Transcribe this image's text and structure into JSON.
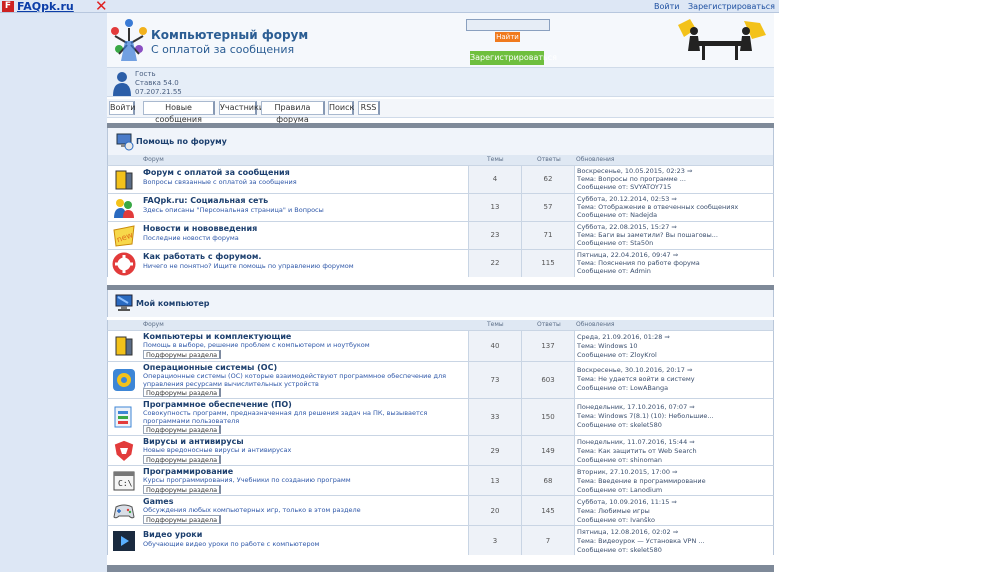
{
  "topbar": {
    "badge": "F",
    "site": "FAQpk.ru",
    "close": "✕",
    "links": [
      "Войти",
      "Зарегистрироваться"
    ]
  },
  "header": {
    "title": "Компьютерный форум",
    "subtitle": "С оплатой за сообщения",
    "search_button": "Найти",
    "search_value": "",
    "register_button": "Зарегистрироваться"
  },
  "userbar": {
    "lines": [
      "Гость",
      "Ставка 54.0",
      "07.207.21.55"
    ]
  },
  "nav": {
    "tabs": [
      "Войти",
      "Новые сообщения",
      "Участники",
      "Правила форума",
      "Поиск",
      "RSS"
    ]
  },
  "columns": {
    "forum": "Форум",
    "topics": "Темы",
    "posts": "Ответы",
    "last": "Обновления"
  },
  "categories": [
    {
      "title": "Помощь по форуму",
      "forums": [
        {
          "title": "Форум с оплатой за сообщения",
          "desc": "Вопросы связанные с оплатой за сообщения",
          "topics": "4",
          "posts": "62",
          "last": [
            "Воскресенье, 10.05.2015, 02:23 ⇒",
            "Тема: Вопросы по программе ...",
            "Сообщение от: SVYATOY715"
          ]
        },
        {
          "title": "FAQpk.ru: Социальная сеть",
          "desc": "Здесь описаны \"Персональная страница\" и Вопросы",
          "topics": "13",
          "posts": "57",
          "last": [
            "Суббота, 20.12.2014, 02:53 ⇒",
            "Тема: Отображение в отвеченных сообщениях",
            "Сообщение от: Nadejda"
          ]
        },
        {
          "title": "Новости и нововведения",
          "desc": "Последние новости форума",
          "topics": "23",
          "posts": "71",
          "last": [
            "Суббота, 22.08.2015, 15:27 ⇒",
            "Тема: Баги вы заметили? Вы пошаговы...",
            "Сообщение от: Sta50n"
          ]
        },
        {
          "title": "Как работать с форумом.",
          "desc": "Ничего не понятно? Ищите помощь по управлению форумом",
          "topics": "22",
          "posts": "115",
          "last": [
            "Пятница, 22.04.2016, 09:47 ⇒",
            "Тема: Пояснения по работе форума",
            "Сообщение от: Admin"
          ]
        }
      ]
    },
    {
      "title": "Мой компьютер",
      "forums": [
        {
          "title": "Компьютеры и комплектующие",
          "desc": "Помощь в выборе, решение проблем с компьютером и ноутбуком",
          "sub": "Подфорумы раздела",
          "topics": "40",
          "posts": "137",
          "last": [
            "Среда, 21.09.2016, 01:28 ⇒",
            "Тема: Windows 10",
            "Сообщение от: ZloyKrol"
          ]
        },
        {
          "title": "Операционные системы (ОС)",
          "desc": "Операционные системы (ОС) которые взаимодействуют программное обеспечение для управления ресурсами вычислительных устройств",
          "sub": "Подфорумы раздела",
          "topics": "73",
          "posts": "603",
          "last": [
            "Воскресенье, 30.10.2016, 20:17 ⇒",
            "Тема: Не удается войти в систему",
            "Сообщение от: LowABanga"
          ]
        },
        {
          "title": "Программное обеспечение (ПО)",
          "desc": "Совокупность программ, предназначенная для решения задач на ПК, вызывается программами пользователя",
          "sub": "Подфорумы раздела",
          "topics": "33",
          "posts": "150",
          "last": [
            "Понедельник, 17.10.2016, 07:07 ⇒",
            "Тема: Windows 7(8.1) (10): Небольшие...",
            "Сообщение от: skelet580"
          ]
        },
        {
          "title": "Вирусы и антивирусы",
          "desc": "Новые вредоносные вирусы и антивирусах",
          "sub": "Подфорумы раздела",
          "topics": "29",
          "posts": "149",
          "last": [
            "Понедельник, 11.07.2016, 15:44 ⇒",
            "Тема: Как защитить от Web Search",
            "Сообщение от: shinoman"
          ]
        },
        {
          "title": "Программирование",
          "desc": "Курсы программирования, Учебники по созданию программ",
          "sub": "Подфорумы раздела",
          "topics": "13",
          "posts": "68",
          "last": [
            "Вторник, 27.10.2015, 17:00 ⇒",
            "Тема: Введение в программирование",
            "Сообщение от: Lanodium"
          ]
        },
        {
          "title": "Games",
          "desc": "Обсуждения любых компьютерных игр, только в этом разделе",
          "sub": "Подфорумы раздела",
          "topics": "20",
          "posts": "145",
          "last": [
            "Суббота, 10.09.2016, 11:15 ⇒",
            "Тема: Любимые игры",
            "Сообщение от: Ivanško"
          ]
        },
        {
          "title": "Видео уроки",
          "desc": "Обучающие видео уроки по работе с компьютером",
          "topics": "3",
          "posts": "7",
          "last": [
            "Пятница, 12.08.2016, 02:02 ⇒",
            "Тема: Видеоурок — Установка VPN ...",
            "Сообщение от: skelet580"
          ]
        }
      ]
    }
  ],
  "colors": {
    "page_bg": "#dde7f5",
    "accent": "#1c3f6e",
    "search_btn": "#f07a1e",
    "register_btn": "#6fbf3e",
    "category_bar": "#7f8a99"
  }
}
